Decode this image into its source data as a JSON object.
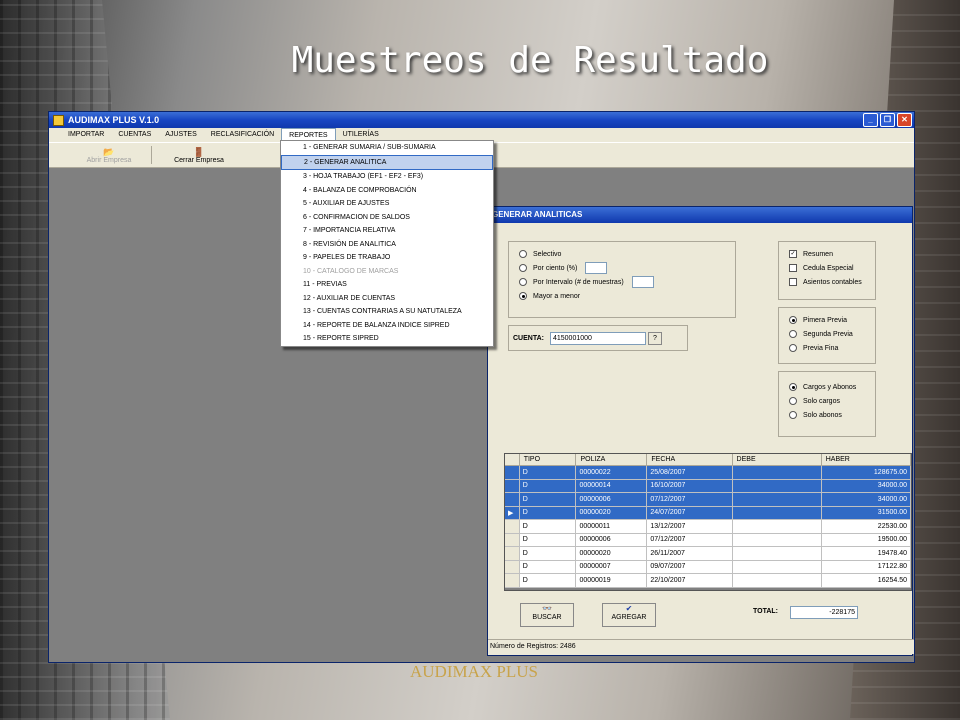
{
  "slide": {
    "title": "Muestreos de Resultado",
    "footer": "AUDIMAX PLUS"
  },
  "app": {
    "title": "AUDIMAX PLUS V.1.0",
    "menu": [
      "IMPORTAR",
      "CUENTAS",
      "AJUSTES",
      "RECLASIFICACIÓN",
      "REPORTES",
      "UTILERÍAS"
    ],
    "toolbar": {
      "open_label": "Abrir Empresa",
      "close_label": "Cerrar Empresa"
    }
  },
  "reportes_menu": [
    "1 - GENERAR SUMARIA / SUB-SUMARIA",
    "2 - GENERAR ANALITICA",
    "3 - HOJA TRABAJO (EF1 - EF2 - EF3)",
    "4 - BALANZA DE COMPROBACIÓN",
    "5 - AUXILIAR DE AJUSTES",
    "6 - CONFIRMACION DE SALDOS",
    "7 - IMPORTANCIA RELATIVA",
    "8 - REVISIÓN DE ANALITICA",
    "9 - PAPELES DE TRABAJO",
    "10 - CATALOGO DE MARCAS",
    "11 - PREVIAS",
    "12 - AUXILIAR DE CUENTAS",
    "13 - CUENTAS CONTRARIAS A SU NATUTALEZA",
    "14 - REPORTE DE BALANZA INDICE SIPRED",
    "15 - REPORTE SIPRED"
  ],
  "analiticas": {
    "title": "GENERAR ANALITICAS",
    "sample_options": [
      "Selectivo",
      "Por ciento (%)",
      "Por Intervalo (# de muestras)",
      "Mayor a menor"
    ],
    "checks": [
      "Resumen",
      "Cedula Especial",
      "Asientos contables"
    ],
    "previa_options": [
      "Pimera Previa",
      "Segunda Previa",
      "Previa Fina"
    ],
    "movement_options": [
      "Cargos y Abonos",
      "Solo cargos",
      "Solo abonos"
    ],
    "cuenta_label": "CUENTA:",
    "cuenta_value": "4150001000",
    "cuenta_btn": "?",
    "grid": {
      "headers": [
        "TIPO",
        "POLIZA",
        "FECHA",
        "DEBE",
        "HABER"
      ],
      "rows": [
        [
          "D",
          "00000022",
          "25/08/2007",
          "",
          "128675.00"
        ],
        [
          "D",
          "00000014",
          "16/10/2007",
          "",
          "34000.00"
        ],
        [
          "D",
          "00000006",
          "07/12/2007",
          "",
          "34000.00"
        ],
        [
          "D",
          "00000020",
          "24/07/2007",
          "",
          "31500.00"
        ],
        [
          "D",
          "00000011",
          "13/12/2007",
          "",
          "22530.00"
        ],
        [
          "D",
          "00000006",
          "07/12/2007",
          "",
          "19500.00"
        ],
        [
          "D",
          "00000020",
          "26/11/2007",
          "",
          "19478.40"
        ],
        [
          "D",
          "00000007",
          "09/07/2007",
          "",
          "17122.80"
        ],
        [
          "D",
          "00000019",
          "22/10/2007",
          "",
          "16254.50"
        ]
      ]
    },
    "buscar_label": "BUSCAR",
    "agregar_label": "AGREGAR",
    "total_label": "TOTAL:",
    "total_value": "-228175",
    "status": "Número de Registros:  2486"
  }
}
